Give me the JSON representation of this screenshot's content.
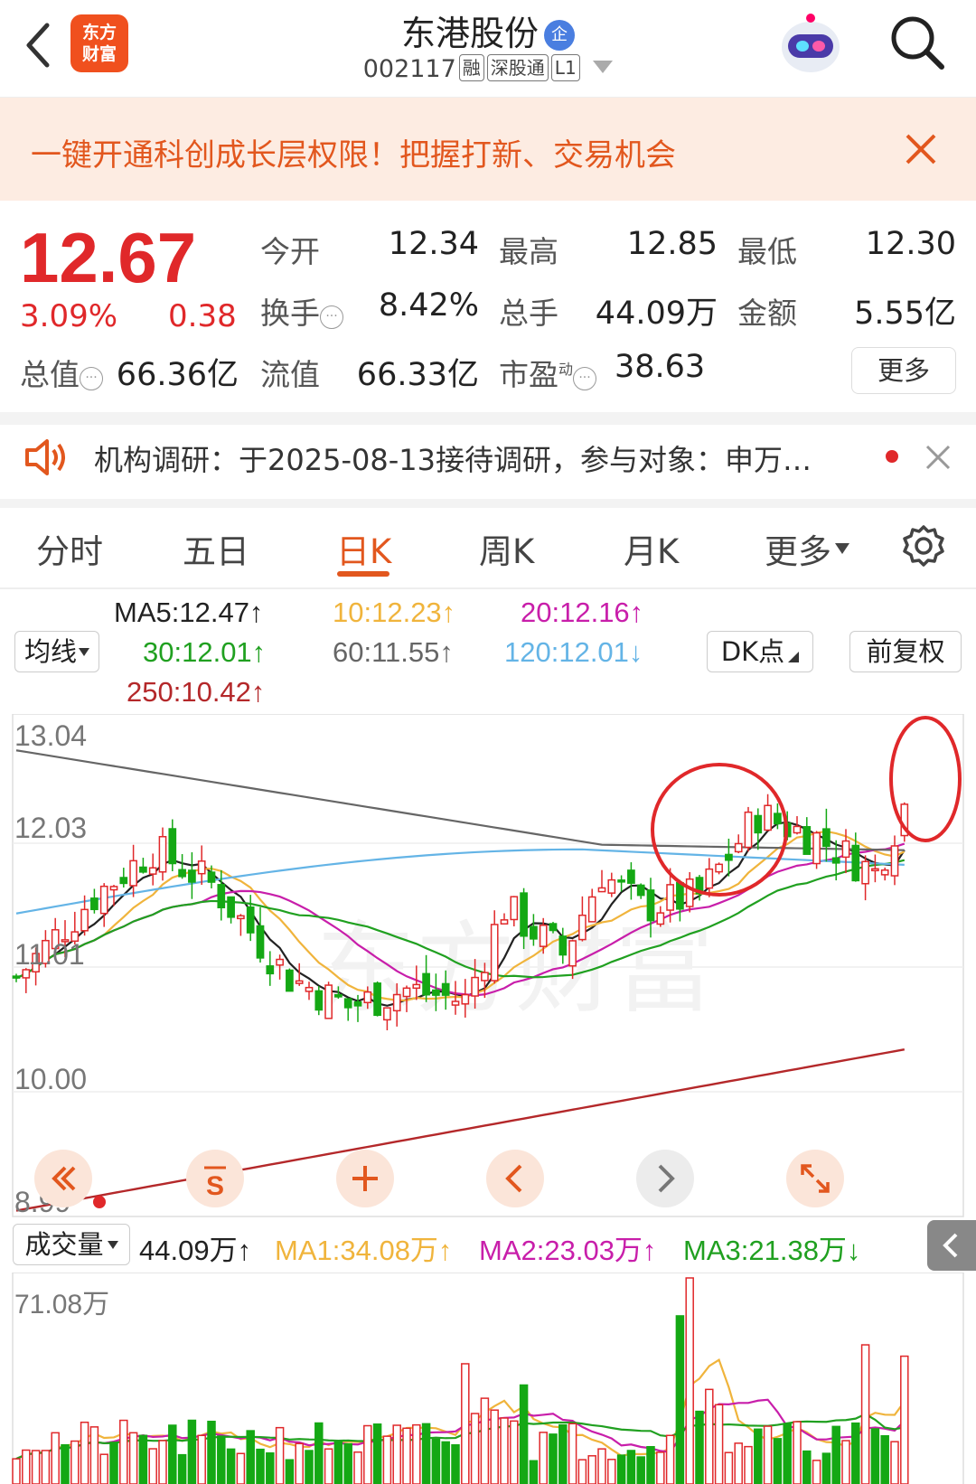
{
  "header": {
    "title": "东港股份",
    "enterprise_badge": "企",
    "code": "002117",
    "tags": [
      "融",
      "深股通",
      "L1"
    ],
    "logo_text_1": "东方",
    "logo_text_2": "财富"
  },
  "banner": {
    "text": "一键开通科创成长层权限！把握打新、交易机会"
  },
  "quote": {
    "price": "12.67",
    "change_pct": "3.09%",
    "change": "0.38",
    "open_label": "今开",
    "open": "12.34",
    "high_label": "最高",
    "high": "12.85",
    "low_label": "最低",
    "low": "12.30",
    "turnover_label": "换手",
    "turnover": "8.42%",
    "volume_label": "总手",
    "volume": "44.09万",
    "amount_label": "金额",
    "amount": "5.55亿",
    "mktcap_label": "总值",
    "mktcap": "66.36亿",
    "float_label": "流值",
    "float": "66.33亿",
    "pe_label": "市盈",
    "pe_sup": "动",
    "pe": "38.63",
    "more": "更多"
  },
  "news": {
    "text": "机构调研：于2025-08-13接待调研，参与对象：申万…"
  },
  "tabs": [
    "分时",
    "五日",
    "日K",
    "周K",
    "月K",
    "更多"
  ],
  "active_tab": "日K",
  "ma_legend": {
    "selector": "均线",
    "ma5": "MA5:12.47↑",
    "ma10": "10:12.23↑",
    "ma20": "20:12.16↑",
    "ma30": "30:12.01↑",
    "ma60": "60:11.55↑",
    "ma120": "120:12.01↓",
    "ma250": "250:10.42↑",
    "dk": "DK点",
    "adjust": "前复权"
  },
  "price_axis": [
    "13.04",
    "12.03",
    "11.01",
    "10.00",
    "8.99"
  ],
  "volume_legend": {
    "selector": "成交量",
    "vol": "44.09万↑",
    "ma1": "MA1:34.08万↑",
    "ma2": "MA2:23.03万↑",
    "ma3": "MA3:21.38万↓",
    "max": "71.08万"
  },
  "watermark": "东方财富",
  "colors": {
    "up": "#e0282a",
    "down": "#14a814",
    "ma5": "#222222",
    "ma10": "#f0b43c",
    "ma20": "#c81eaa",
    "ma30": "#20a020",
    "ma60": "#666666",
    "ma120": "#64b4e6",
    "ma250": "#b4282a",
    "accent": "#e2571e"
  }
}
